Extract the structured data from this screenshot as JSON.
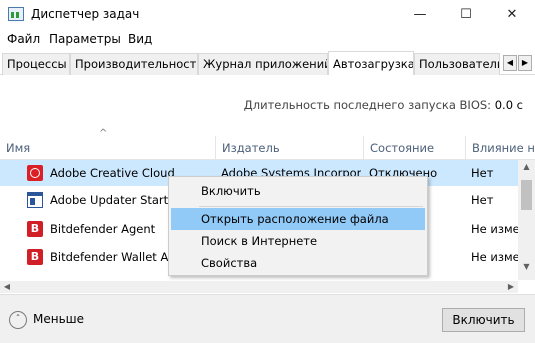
{
  "window": {
    "title": "Диспетчер задач",
    "minimize_glyph": "—",
    "maximize_glyph": "☐",
    "close_glyph": "✕"
  },
  "menu": [
    "Файл",
    "Параметры",
    "Вид"
  ],
  "tabs": [
    {
      "label": "Процессы",
      "active": false
    },
    {
      "label": "Производительность",
      "active": false
    },
    {
      "label": "Журнал приложений",
      "active": false
    },
    {
      "label": "Автозагрузка",
      "active": true
    },
    {
      "label": "Пользователи",
      "active": false
    }
  ],
  "tab_scroll": {
    "left": "◀",
    "right": "▶"
  },
  "bios": {
    "label": "Длительность последнего запуска BIOS:",
    "value": "0.0 с"
  },
  "columns": {
    "name": "Имя",
    "publisher": "Издатель",
    "status": "Состояние",
    "impact": "Влияние на"
  },
  "rows": [
    {
      "icon": "adobe-creative-cloud-icon",
      "name": "Adobe Creative Cloud",
      "publisher": "Adobe Systems Incorpor",
      "status": "Отключено",
      "impact": "Нет",
      "selected": true
    },
    {
      "icon": "adobe-updater-icon",
      "name": "Adobe Updater Startup",
      "publisher": "",
      "status": "",
      "impact": "Нет",
      "selected": false
    },
    {
      "icon": "bitdefender-icon",
      "name": "Bitdefender Agent",
      "publisher": "",
      "status": "",
      "impact": "Не измер",
      "selected": false
    },
    {
      "icon": "bitdefender-icon",
      "name": "Bitdefender Wallet Ag",
      "publisher": "",
      "status": "",
      "impact": "Не измер",
      "selected": false
    }
  ],
  "bitdefender_glyph": "B",
  "scroll": {
    "up": "▲",
    "down": "▼",
    "left": "◀",
    "right": "▶",
    "sort": "^"
  },
  "context_menu": [
    {
      "label": "Включить",
      "hover": false
    },
    {
      "label": "Открыть расположение файла",
      "hover": true
    },
    {
      "label": "Поиск в Интернете",
      "hover": false
    },
    {
      "label": "Свойства",
      "hover": false
    }
  ],
  "footer": {
    "less_icon": "ˆ",
    "less_label": "Меньше",
    "enable_label": "Включить"
  },
  "colors": {
    "selected_row": "#cce8ff",
    "menu_hover": "#91c9f7",
    "bitdefender_red": "#d01f27",
    "adobe_red": "#da1f26",
    "header_text": "#4c607a"
  }
}
